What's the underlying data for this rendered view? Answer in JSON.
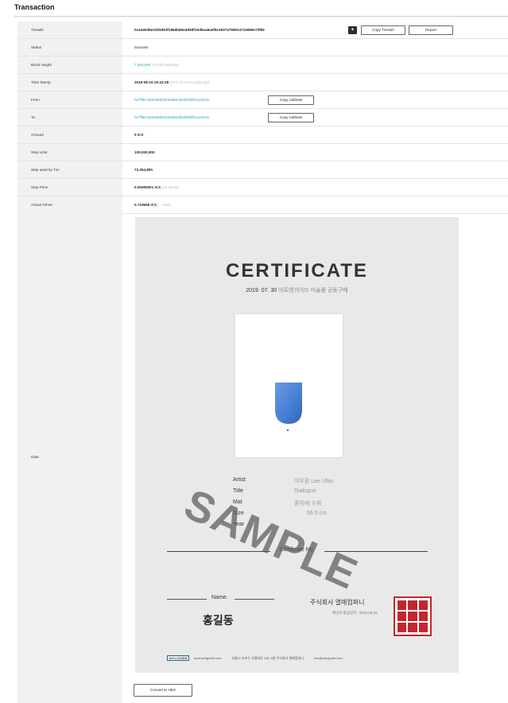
{
  "page": {
    "title": "Transaction"
  },
  "rows": {
    "txhash": {
      "label": "TxHash",
      "value": "0x3440d9e2383d63f1966b69add69f1dd9aa9aef5ce8374769914716999e73f99"
    },
    "status": {
      "label": "Status",
      "value": "Success"
    },
    "block_height": {
      "label": "Block Height",
      "value": "7,302,894",
      "note": "( Confirmation(s)"
    },
    "time_stamp": {
      "label": "Time Stamp",
      "value": "2019-08-15 15:42:28",
      "note": "(UTC+9, 8 seconds ago)"
    },
    "from": {
      "label": "From",
      "value": "hx7ff5e7a00268fe0c5096a491f6f2bf81a151eb"
    },
    "to": {
      "label": "To",
      "value": "hx7ff5e7a00268fe0c5096a491f6f2bf81a151eb"
    },
    "amount": {
      "label": "Amount",
      "value": "0 ICX"
    },
    "step_limit": {
      "label": "Step Limit",
      "value": "100,000,000"
    },
    "step_used": {
      "label": "Step used by Txn",
      "value": "73,354,800"
    },
    "step_price": {
      "label": "Step Price",
      "value": "0.00000001 ICX",
      "note": "(10 Gloop)"
    },
    "actual_fee": {
      "label": "Actual TxFee",
      "value": "0.733548 ICX",
      "note": "( - USD)"
    },
    "data": {
      "label": "Data"
    }
  },
  "buttons": {
    "copy_txhash": "Copy TxHash",
    "report": "Report",
    "copy_address": "Copy Address",
    "convert_hex": "Convert to HEX"
  },
  "certificate": {
    "title": "CERTIFICATE",
    "date": "2019. 07. 30",
    "subtitle": "아트앤가이드 미술품 공동구매",
    "artist_label": "Artist",
    "artist": "이우환 Lee Ufan",
    "title_label": "Title",
    "title_value": "Dialogue",
    "material_label": "Mat",
    "material": "종이에 수채",
    "size_label": "Size",
    "size": "56.5 cm",
    "year_label": "Year",
    "cert_no_label": "Certificate No.",
    "name_label": "Name.",
    "name_value": "홍길동",
    "company": "주식회사 열매컴퍼니",
    "company_sub": "확인서 발급일자 : 2019.08.26",
    "watermark": "SAMPLE",
    "footer_logo": "art n GUIDE",
    "footer_url": "www.artnguide.com",
    "footer_address": "서울시 서초구 사평대로 148, 9층 주식회사 열매컴퍼니",
    "footer_email": "info@artnguide.com"
  },
  "colors": {
    "link": "#2aa1c0",
    "seal": "#c4262e",
    "artwork_blue": "#2f6fd0"
  },
  "icons": {
    "share": "twitter-icon"
  }
}
